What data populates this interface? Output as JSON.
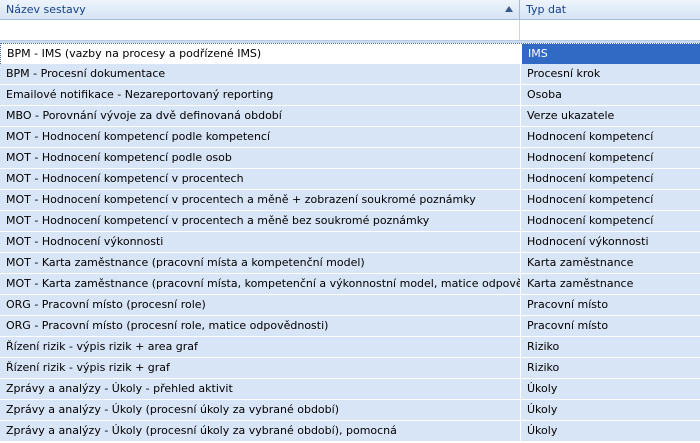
{
  "columns": {
    "name_header": "Název sestavy",
    "type_header": "Typ dat"
  },
  "filter": {
    "name_value": "",
    "type_value": ""
  },
  "rows": [
    {
      "name": "BPM - IMS (vazby na procesy a podřízené IMS)",
      "type": "IMS"
    },
    {
      "name": "BPM - Procesní dokumentace",
      "type": "Procesní krok"
    },
    {
      "name": "Emailové notifikace - Nezareportovaný reporting",
      "type": "Osoba"
    },
    {
      "name": "MBO - Porovnání vývoje za dvě definovaná období",
      "type": "Verze ukazatele"
    },
    {
      "name": "MOT - Hodnocení kompetencí podle kompetencí",
      "type": "Hodnocení kompetencí"
    },
    {
      "name": "MOT - Hodnocení kompetencí podle osob",
      "type": "Hodnocení kompetencí"
    },
    {
      "name": "MOT - Hodnocení kompetencí v procentech",
      "type": "Hodnocení kompetencí"
    },
    {
      "name": "MOT - Hodnocení kompetencí v procentech a měně + zobrazení soukromé poznámky",
      "type": "Hodnocení kompetencí"
    },
    {
      "name": "MOT - Hodnocení kompetencí v procentech a měně bez soukromé poznámky",
      "type": "Hodnocení kompetencí"
    },
    {
      "name": "MOT - Hodnocení výkonnosti",
      "type": "Hodnocení výkonnosti"
    },
    {
      "name": "MOT - Karta zaměstnance (pracovní místa a kompetenční model)",
      "type": "Karta zaměstnance"
    },
    {
      "name": "MOT - Karta zaměstnance (pracovní místa, kompetenční a výkonnostní model, matice odpovědnosti)",
      "type": "Karta zaměstnance"
    },
    {
      "name": "ORG - Pracovní místo (procesní role)",
      "type": "Pracovní místo"
    },
    {
      "name": "ORG - Pracovní místo (procesní role, matice odpovědnosti)",
      "type": "Pracovní místo"
    },
    {
      "name": "Řízení rizik - výpis rizik + area graf",
      "type": "Riziko"
    },
    {
      "name": "Řízení rizik - výpis rizik + graf",
      "type": "Riziko"
    },
    {
      "name": "Zprávy a analýzy - Úkoly - přehled aktivit",
      "type": "Úkoly"
    },
    {
      "name": "Zprávy a analýzy - Úkoly (procesní úkoly za vybrané období)",
      "type": "Úkoly"
    },
    {
      "name": "Zprávy a analýzy - Úkoly (procesní úkoly za vybrané období), pomocná",
      "type": "Úkoly"
    }
  ]
}
